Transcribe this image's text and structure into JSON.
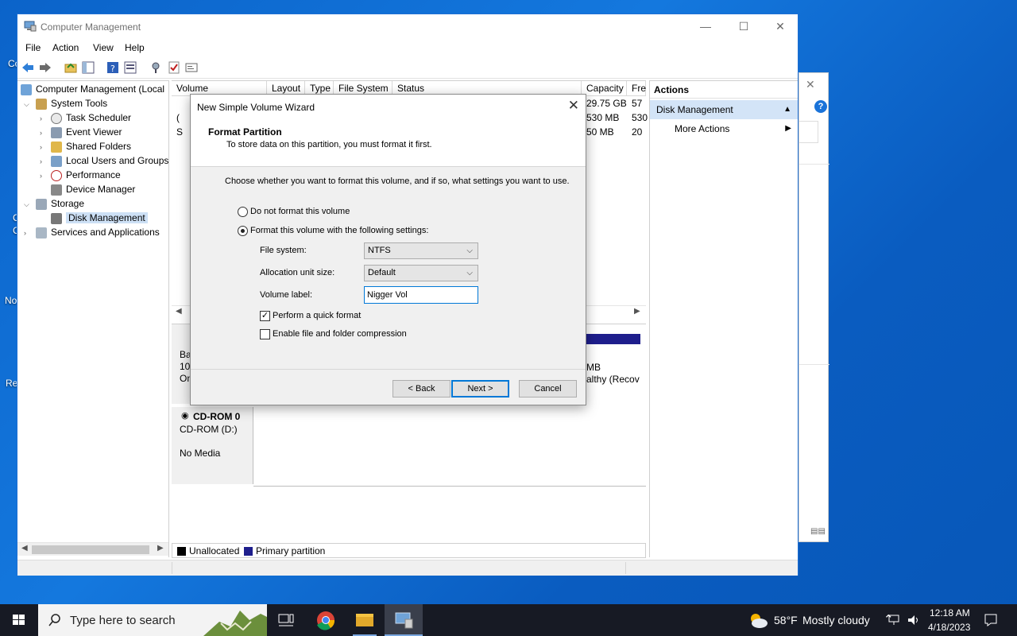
{
  "desktop": {
    "icon_labels": [
      "Co",
      "C",
      "C",
      "No",
      "Re"
    ]
  },
  "window": {
    "title": "Computer Management",
    "controls": {
      "minimize": "—",
      "maximize": "☐",
      "close": "✕"
    },
    "menu": [
      "File",
      "Action",
      "View",
      "Help"
    ]
  },
  "tree": {
    "root": "Computer Management (Local",
    "items": [
      {
        "label": "System Tools"
      },
      {
        "label": "Task Scheduler"
      },
      {
        "label": "Event Viewer"
      },
      {
        "label": "Shared Folders"
      },
      {
        "label": "Local Users and Groups"
      },
      {
        "label": "Performance"
      },
      {
        "label": "Device Manager"
      },
      {
        "label": "Storage"
      },
      {
        "label": "Disk Management"
      },
      {
        "label": "Services and Applications"
      }
    ]
  },
  "volume_list": {
    "columns": [
      "Volume",
      "Layout",
      "Type",
      "File System",
      "Status",
      "Capacity",
      "Fre"
    ],
    "rows": [
      {
        "capacity": "29.75 GB",
        "free": "57"
      },
      {
        "capacity": "530 MB",
        "free": "530"
      },
      {
        "capacity": "50 MB",
        "free": "20"
      }
    ],
    "row_prefix": [
      "",
      "(",
      "S"
    ]
  },
  "graphical": {
    "disk0_partial": [
      "Ba",
      "100",
      "On"
    ],
    "partition_right": [
      "MB",
      "althy (Recov"
    ],
    "cdrom": {
      "name": "CD-ROM 0",
      "drive": "CD-ROM (D:)",
      "media": "No Media"
    },
    "legend": {
      "unallocated": "Unallocated",
      "primary": "Primary partition",
      "unallocated_color": "#000000",
      "primary_color": "#1e1e8c"
    }
  },
  "actions": {
    "header": "Actions",
    "section": "Disk Management",
    "item": "More Actions"
  },
  "dialog": {
    "title": "New Simple Volume Wizard",
    "heading": "Format Partition",
    "subheading": "To store data on this partition, you must format it first.",
    "instruction": "Choose whether you want to format this volume, and if so, what settings you want to use.",
    "option_no_format": "Do not format this volume",
    "option_format": "Format this volume with the following settings:",
    "selected_option": "format",
    "file_system_label": "File system:",
    "file_system_value": "NTFS",
    "alloc_label": "Allocation unit size:",
    "alloc_value": "Default",
    "volume_label_label": "Volume label:",
    "volume_label_value": "Nigger Vol",
    "quick_format_label": "Perform a quick format",
    "quick_format_checked": true,
    "compression_label": "Enable file and folder compression",
    "compression_checked": false,
    "buttons": {
      "back": "< Back",
      "next": "Next >",
      "cancel": "Cancel"
    }
  },
  "taskbar": {
    "search_placeholder": "Type here to search",
    "weather_temp": "58°F",
    "weather_text": "Mostly cloudy",
    "time": "12:18 AM",
    "date": "4/18/2023"
  },
  "colors": {
    "accent": "#0078d7",
    "selection": "#cde0f5",
    "taskbar": "#171a24"
  }
}
